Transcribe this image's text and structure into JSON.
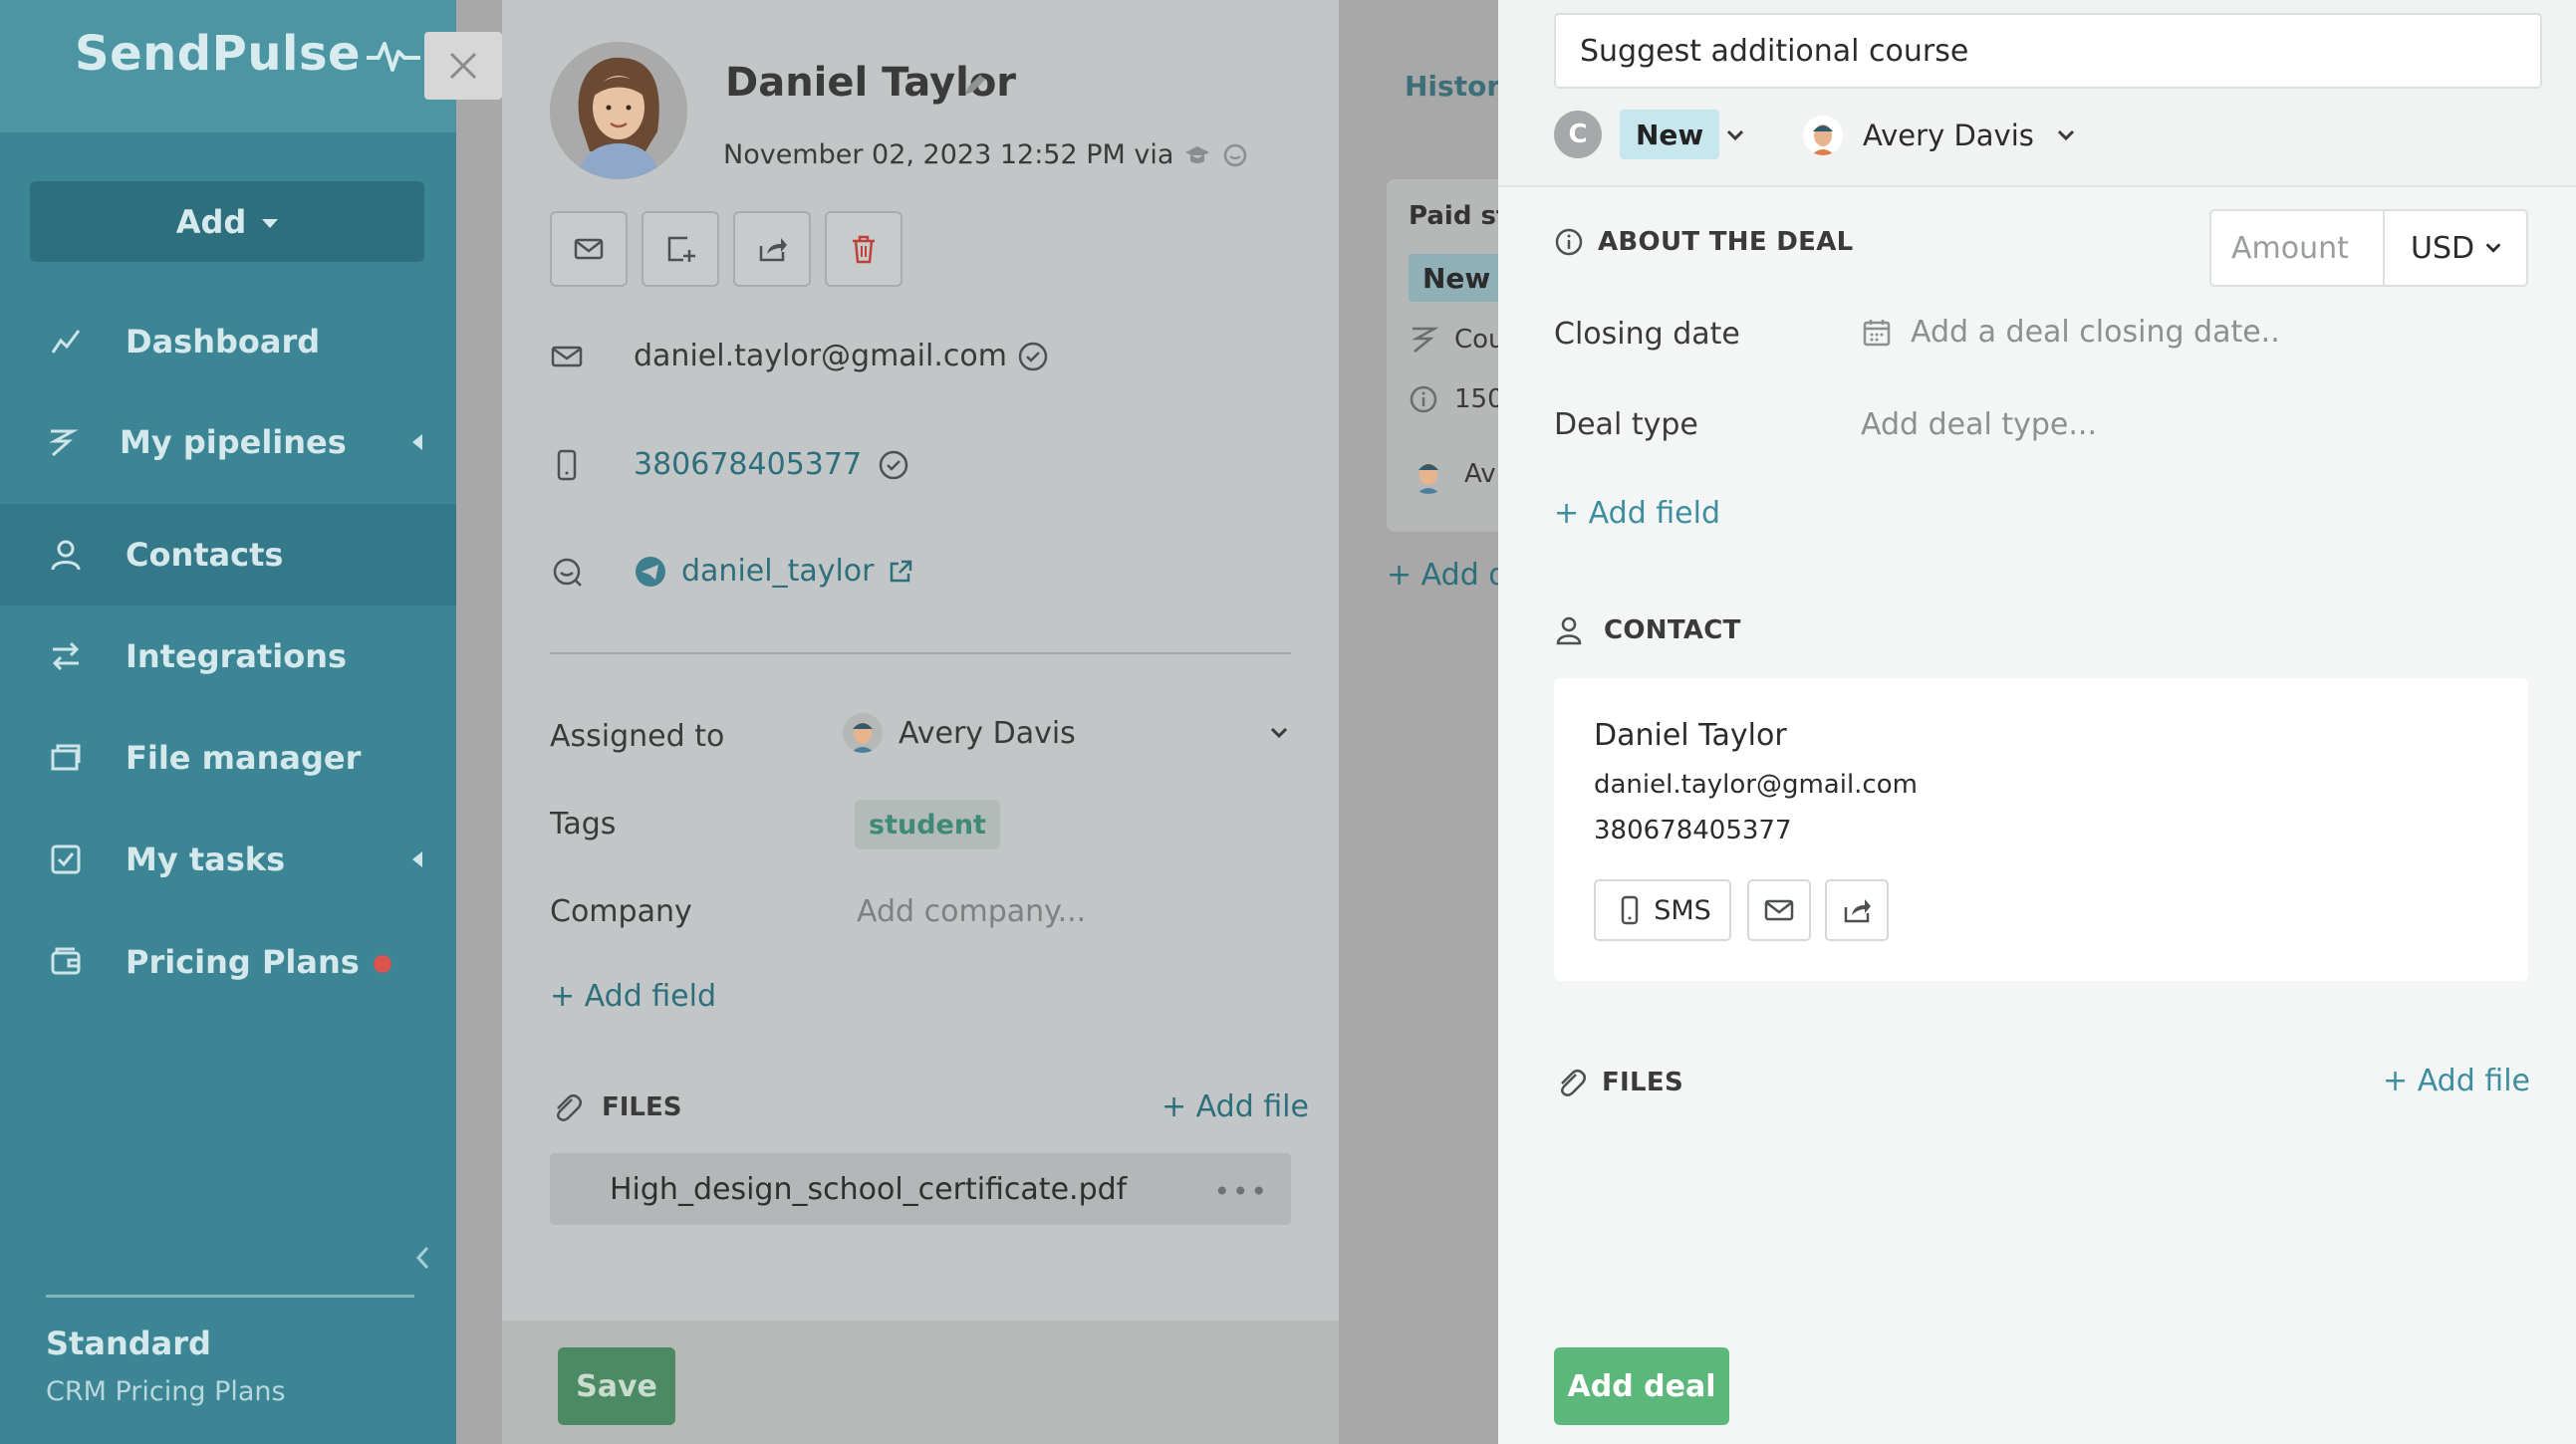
{
  "sidebar": {
    "logo": "SendPulse",
    "add_button": "Add",
    "items": [
      {
        "label": "Dashboard",
        "icon": "chart-line-icon"
      },
      {
        "label": "My pipelines",
        "icon": "pipelines-icon"
      },
      {
        "label": "Contacts",
        "icon": "contacts-icon"
      },
      {
        "label": "Integrations",
        "icon": "integrations-icon"
      },
      {
        "label": "File manager",
        "icon": "folder-icon"
      },
      {
        "label": "My tasks",
        "icon": "tasks-icon"
      },
      {
        "label": "Pricing Plans",
        "icon": "wallet-icon"
      }
    ],
    "plan_name": "Standard",
    "plan_sub": "CRM Pricing Plans"
  },
  "contact": {
    "name": "Daniel Taylor",
    "date": "November 02, 2023 12:52 PM via",
    "email": "daniel.taylor@gmail.com",
    "phone": "380678405377",
    "telegram": "daniel_taylor",
    "assigned_label": "Assigned to",
    "assigned_value": "Avery Davis",
    "tags_label": "Tags",
    "tag": "student",
    "company_label": "Company",
    "company_placeholder": "Add company...",
    "add_field": "+ Add field",
    "files_title": "FILES",
    "add_file": "+ Add file",
    "file_name": "High_design_school_certificate.pdf",
    "file_menu": "•••",
    "save": "Save"
  },
  "history": {
    "title": "History",
    "deal_title": "Paid stu",
    "deal_stage": "New",
    "row1": "Cou",
    "row2": "150",
    "row3": "Av",
    "add": "+ Add de"
  },
  "deal": {
    "title_value": "Suggest additional course",
    "avatar_letter": "C",
    "stage": "New",
    "owner": "Avery Davis",
    "about_title": "ABOUT THE DEAL",
    "amount_placeholder": "Amount",
    "currency": "USD",
    "closing_label": "Closing date",
    "closing_placeholder": "Add a deal closing date..",
    "type_label": "Deal type",
    "type_placeholder": "Add deal type...",
    "add_field": "+ Add field",
    "contact_title": "CONTACT",
    "contact_name": "Daniel Taylor",
    "contact_email": "daniel.taylor@gmail.com",
    "contact_phone": "380678405377",
    "sms_label": "SMS",
    "files_title": "FILES",
    "add_file": "+ Add file",
    "add_deal": "Add deal"
  },
  "colors": {
    "sidebar": "#3c8595",
    "accent": "#3e8ea0",
    "add_deal": "#5cb87a",
    "stage_badge": "#c7e6ee",
    "tag": "#3e8a76"
  }
}
